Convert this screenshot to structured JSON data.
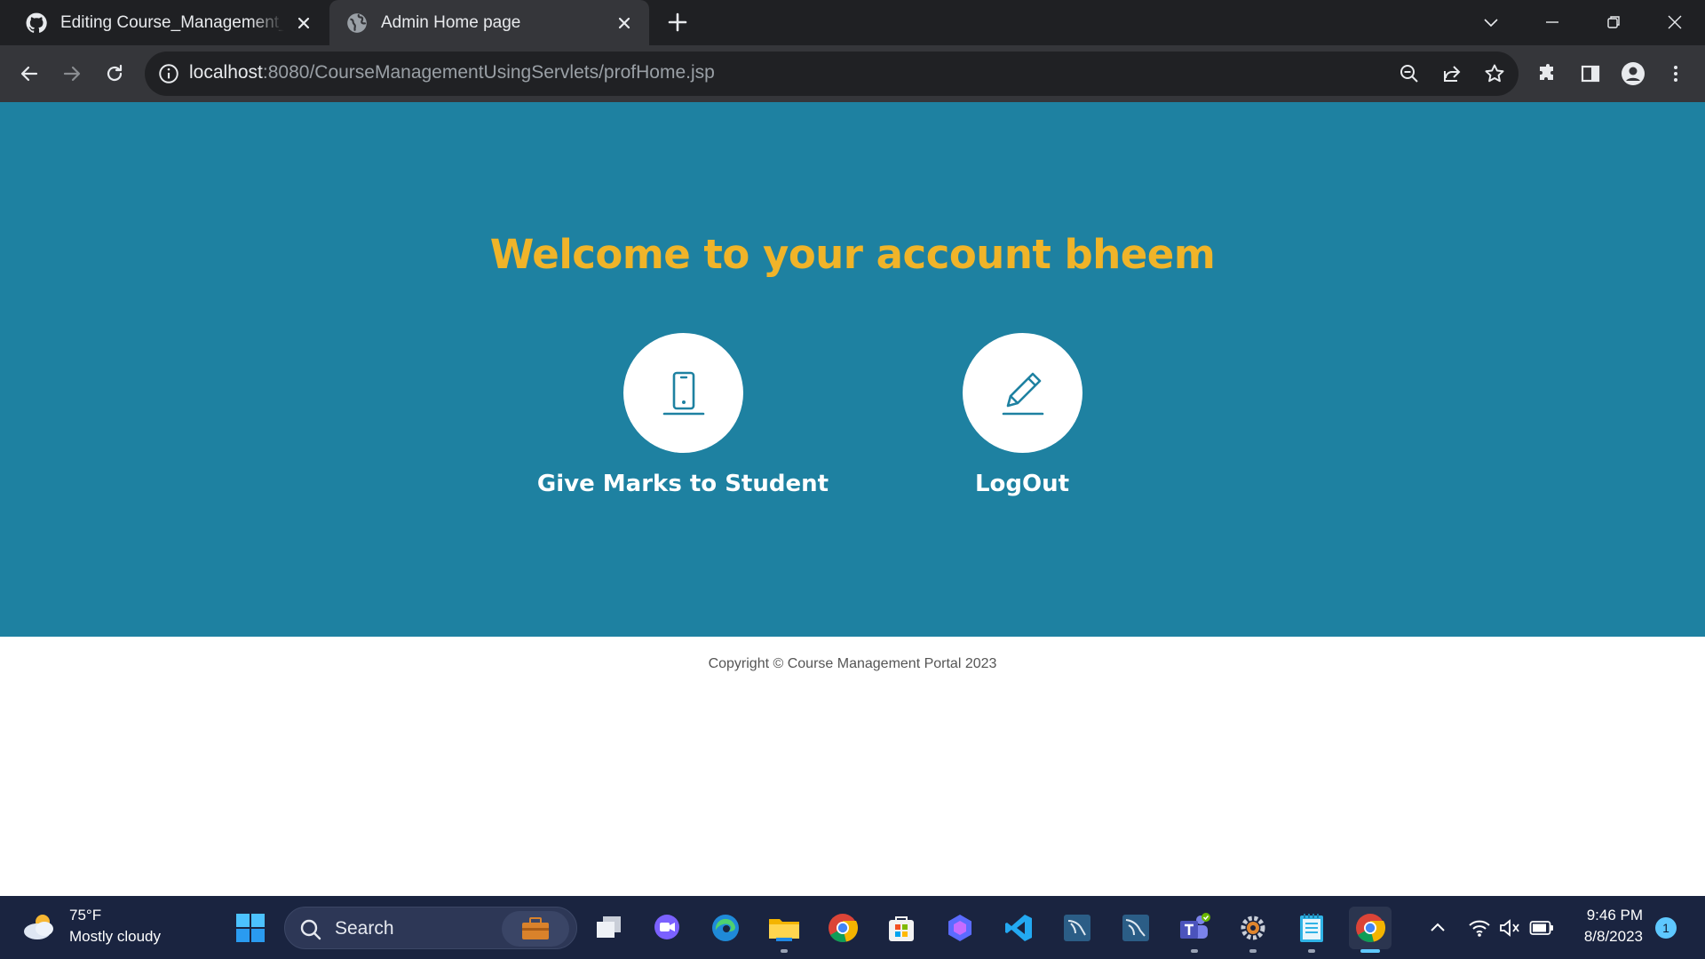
{
  "browser": {
    "tabs": [
      {
        "title": "Editing Course_Management_using_Servlets",
        "icon": "github-icon",
        "active": false
      },
      {
        "title": "Admin Home page",
        "icon": "globe-icon",
        "active": true
      }
    ],
    "url_host": "localhost",
    "url_rest": ":8080/CourseManagementUsingServlets/profHome.jsp"
  },
  "page": {
    "welcome": "Welcome to your account bheem",
    "actions": [
      {
        "label": "Give Marks to Student",
        "icon": "mobile-phone-icon"
      },
      {
        "label": "LogOut",
        "icon": "pencil-icon"
      }
    ],
    "copyright": "Copyright © Course Management Portal 2023"
  },
  "taskbar": {
    "weather_temp": "75°F",
    "weather_desc": "Mostly cloudy",
    "search_label": "Search",
    "time": "9:46 PM",
    "date": "8/8/2023",
    "notification_count": "1"
  },
  "colors": {
    "hero_bg": "#1e81a1",
    "welcome_text": "#f0b429",
    "tab_bg": "#1f2023",
    "toolbar_bg": "#35363a",
    "taskbar_bg": "#1a2440"
  }
}
